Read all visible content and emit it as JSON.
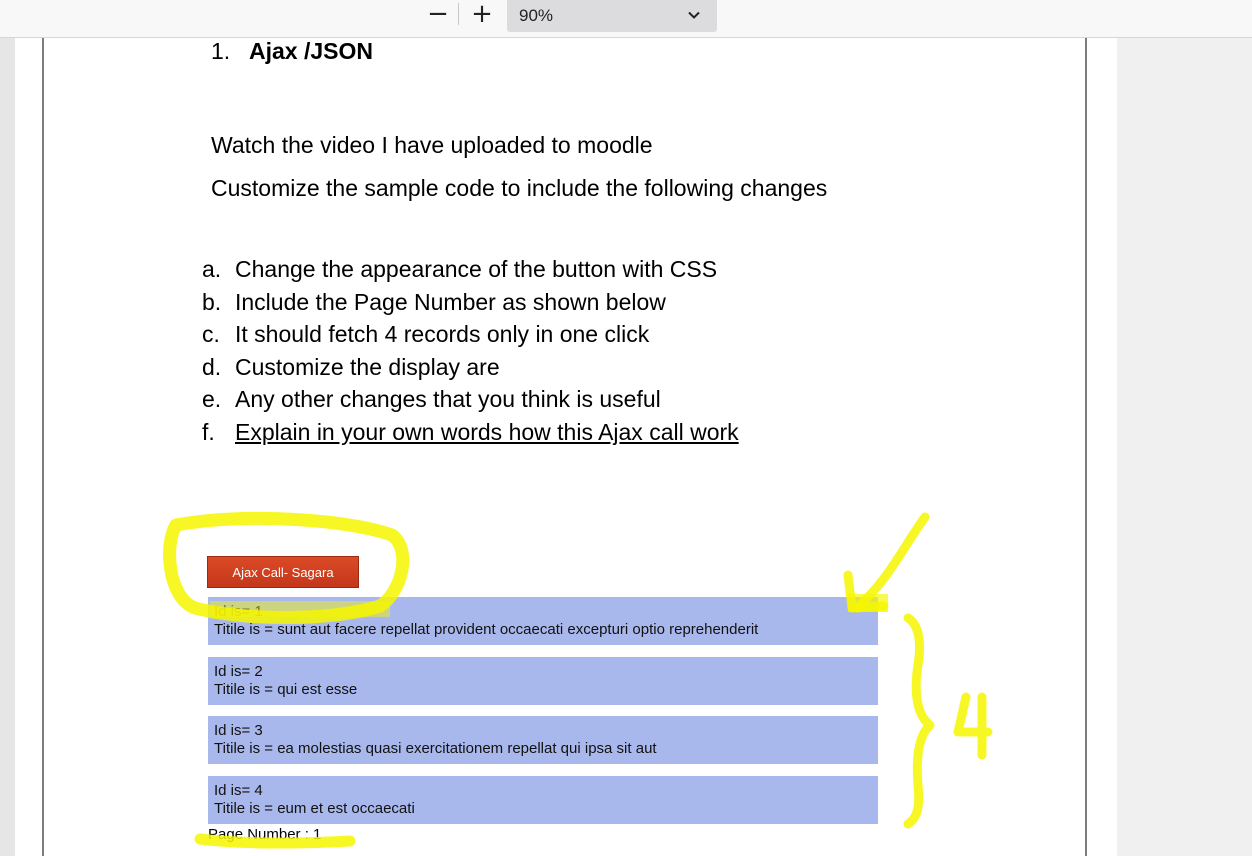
{
  "toolbar": {
    "zoom_out_symbol": "−",
    "zoom_in_symbol": "+",
    "zoom_value": "90%",
    "zoom_chevron_icon": "chevron-down-icon"
  },
  "document": {
    "heading_number": "1.",
    "heading_text": "Ajax /JSON",
    "paragraphs": [
      "Watch the video I have uploaded to moodle",
      "Customize the sample code to include the following changes"
    ],
    "list": [
      {
        "marker": "a.",
        "text": "Change the appearance of the button with CSS"
      },
      {
        "marker": "b.",
        "text": "Include the Page Number as shown below"
      },
      {
        "marker": "c.",
        "text": "It should fetch 4 records only in one click"
      },
      {
        "marker": "d.",
        "text": "Customize the display are"
      },
      {
        "marker": "e.",
        "text": "Any other changes that you think is useful"
      },
      {
        "marker": "f.",
        "text": "Explain in your own words how this Ajax call work"
      }
    ]
  },
  "sample": {
    "button_label": "Ajax Call- Sagara",
    "records": [
      {
        "id_line": "Id is= 1",
        "title_line": "Titile is = sunt aut facere repellat provident occaecati excepturi optio reprehenderit"
      },
      {
        "id_line": "Id is= 2",
        "title_line": "Titile is = qui est esse"
      },
      {
        "id_line": "Id is= 3",
        "title_line": "Titile is = ea molestias quasi exercitationem repellat qui ipsa sit aut"
      },
      {
        "id_line": "Id is= 4",
        "title_line": "Titile is = eum et est occaecati"
      }
    ],
    "page_number": "Page Number : 1"
  },
  "colors": {
    "button": "#c93b1e",
    "record_bg": "#a9b8ec",
    "highlighter": "#f6f600"
  }
}
